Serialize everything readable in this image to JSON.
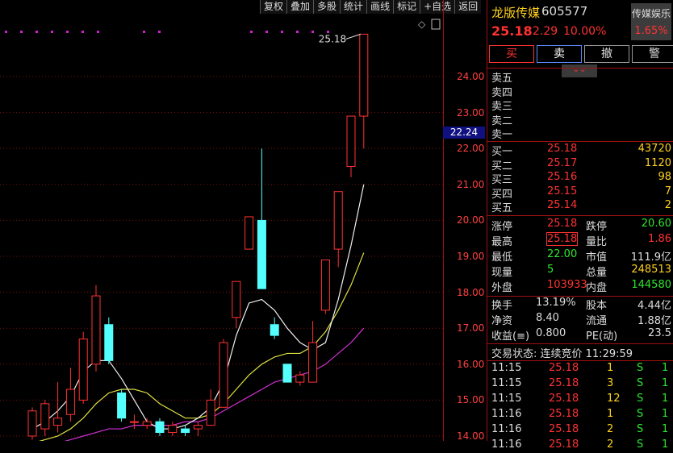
{
  "toolbar": [
    "复权",
    "叠加",
    "多股",
    "统计",
    "画线",
    "标记",
    "+自选",
    "返回"
  ],
  "chart": {
    "last_label": "25.18",
    "current_price_tag": "22.24",
    "y_ticks": [
      "24.00",
      "23.00",
      "22.00",
      "21.00",
      "20.00",
      "19.00",
      "18.00",
      "17.00",
      "16.00",
      "15.00",
      "14.00"
    ]
  },
  "chart_data": {
    "type": "candlestick",
    "ylim": [
      14.0,
      25.2
    ],
    "candles": [
      {
        "o": 14.0,
        "h": 14.8,
        "l": 13.9,
        "c": 14.7
      },
      {
        "o": 14.2,
        "h": 15.0,
        "l": 14.0,
        "c": 14.9
      },
      {
        "o": 14.3,
        "h": 15.5,
        "l": 14.1,
        "c": 14.5
      },
      {
        "o": 14.6,
        "h": 15.9,
        "l": 14.4,
        "c": 15.3
      },
      {
        "o": 15.0,
        "h": 16.9,
        "l": 14.9,
        "c": 16.7
      },
      {
        "o": 16.0,
        "h": 18.2,
        "l": 15.8,
        "c": 17.9
      },
      {
        "o": 17.1,
        "h": 17.3,
        "l": 16.0,
        "c": 16.1
      },
      {
        "o": 15.2,
        "h": 15.3,
        "l": 14.4,
        "c": 14.5
      },
      {
        "o": 14.4,
        "h": 14.6,
        "l": 14.2,
        "c": 14.4
      },
      {
        "o": 14.3,
        "h": 14.5,
        "l": 14.2,
        "c": 14.4
      },
      {
        "o": 14.4,
        "h": 14.5,
        "l": 14.0,
        "c": 14.1
      },
      {
        "o": 14.1,
        "h": 14.4,
        "l": 14.0,
        "c": 14.3
      },
      {
        "o": 14.2,
        "h": 14.3,
        "l": 14.0,
        "c": 14.1
      },
      {
        "o": 14.2,
        "h": 14.4,
        "l": 14.0,
        "c": 14.3
      },
      {
        "o": 14.3,
        "h": 15.3,
        "l": 14.3,
        "c": 15.0
      },
      {
        "o": 14.8,
        "h": 16.7,
        "l": 14.8,
        "c": 16.6
      },
      {
        "o": 17.3,
        "h": 18.3,
        "l": 17.0,
        "c": 18.3
      },
      {
        "o": 19.2,
        "h": 20.1,
        "l": 19.2,
        "c": 20.1
      },
      {
        "o": 20.0,
        "h": 22.0,
        "l": 18.1,
        "c": 18.1
      },
      {
        "o": 17.1,
        "h": 17.3,
        "l": 16.7,
        "c": 16.8
      },
      {
        "o": 16.0,
        "h": 16.0,
        "l": 15.5,
        "c": 15.5
      },
      {
        "o": 15.5,
        "h": 15.8,
        "l": 15.4,
        "c": 15.7
      },
      {
        "o": 15.5,
        "h": 17.2,
        "l": 15.5,
        "c": 16.6
      },
      {
        "o": 17.5,
        "h": 18.9,
        "l": 17.4,
        "c": 18.9
      },
      {
        "o": 19.2,
        "h": 20.8,
        "l": 18.7,
        "c": 20.8
      },
      {
        "o": 21.5,
        "h": 22.9,
        "l": 21.2,
        "c": 22.9
      },
      {
        "o": 22.9,
        "h": 25.18,
        "l": 22.0,
        "c": 25.18
      }
    ],
    "ma_white": [
      14.2,
      14.4,
      14.7,
      15.1,
      15.8,
      16.1,
      16.1,
      15.6,
      15.0,
      14.4,
      14.2,
      14.2,
      14.3,
      14.5,
      14.8,
      15.5,
      16.8,
      17.7,
      17.8,
      17.5,
      17.0,
      16.6,
      16.4,
      16.6,
      17.8,
      19.3,
      21.0
    ],
    "ma_yellow": [
      13.8,
      13.9,
      14.0,
      14.2,
      14.5,
      14.9,
      15.2,
      15.3,
      15.3,
      15.2,
      14.9,
      14.7,
      14.5,
      14.5,
      14.6,
      14.9,
      15.3,
      15.7,
      16.0,
      16.2,
      16.3,
      16.3,
      16.5,
      16.9,
      17.5,
      18.2,
      19.1
    ],
    "ma_magenta": [
      13.6,
      13.7,
      13.8,
      13.9,
      14.0,
      14.1,
      14.2,
      14.2,
      14.3,
      14.3,
      14.3,
      14.3,
      14.4,
      14.4,
      14.5,
      14.7,
      14.9,
      15.1,
      15.3,
      15.5,
      15.6,
      15.7,
      15.8,
      16.0,
      16.3,
      16.6,
      17.0
    ]
  },
  "quote": {
    "name": "龙版传媒",
    "code": "605577",
    "price": "25.18",
    "change": "2.29",
    "pct": "10.00%",
    "sector_name": "传媒娱乐",
    "sector_pct": "1.65%",
    "btn_buy": "买",
    "btn_sell": "卖",
    "btn_cancel": "撤",
    "btn_alert": "警",
    "expand": "⌄⌄",
    "asks": [
      {
        "label": "卖五",
        "price": "",
        "vol": ""
      },
      {
        "label": "卖四",
        "price": "",
        "vol": ""
      },
      {
        "label": "卖三",
        "price": "",
        "vol": ""
      },
      {
        "label": "卖二",
        "price": "",
        "vol": ""
      },
      {
        "label": "卖一",
        "price": "",
        "vol": ""
      }
    ],
    "bids": [
      {
        "label": "买一",
        "price": "25.18",
        "vol": "43720"
      },
      {
        "label": "买二",
        "price": "25.17",
        "vol": "1120"
      },
      {
        "label": "买三",
        "price": "25.16",
        "vol": "98"
      },
      {
        "label": "买四",
        "price": "25.15",
        "vol": "7"
      },
      {
        "label": "买五",
        "price": "25.14",
        "vol": "2"
      }
    ],
    "stats": [
      {
        "k1": "涨停",
        "v1": "25.18",
        "k2": "跌停",
        "v2": "20.60"
      },
      {
        "k1": "最高",
        "v1": "25.18",
        "k2": "量比",
        "v2": "1.86"
      },
      {
        "k1": "最低",
        "v1": "22.00",
        "k2": "市值",
        "v2": "111.9亿"
      },
      {
        "k1": "现量",
        "v1": "5",
        "k2": "总量",
        "v2": "248513"
      },
      {
        "k1": "外盘",
        "v1": "103933",
        "k2": "内盘",
        "v2": "144580"
      }
    ],
    "fund": [
      {
        "k1": "换手",
        "v1": "13.19%",
        "k2": "股本",
        "v2": "4.44亿"
      },
      {
        "k1": "净资",
        "v1": "8.40",
        "k2": "流通",
        "v2": "1.88亿"
      },
      {
        "k1": "收益(≡)",
        "v1": "0.800",
        "k2": "PE(动)",
        "v2": "23.5"
      }
    ],
    "status_label": "交易状态: 连续竞价 11:29:59",
    "ticks": [
      {
        "t": "11:15",
        "p": "25.18",
        "v": "1",
        "s": "S",
        "n": "1"
      },
      {
        "t": "11:15",
        "p": "25.18",
        "v": "3",
        "s": "S",
        "n": "1"
      },
      {
        "t": "11:15",
        "p": "25.18",
        "v": "12",
        "s": "S",
        "n": "1"
      },
      {
        "t": "11:16",
        "p": "25.18",
        "v": "1",
        "s": "S",
        "n": "1"
      },
      {
        "t": "11:16",
        "p": "25.18",
        "v": "2",
        "s": "S",
        "n": "1"
      },
      {
        "t": "11:16",
        "p": "25.18",
        "v": "2",
        "s": "S",
        "n": "1"
      }
    ]
  }
}
